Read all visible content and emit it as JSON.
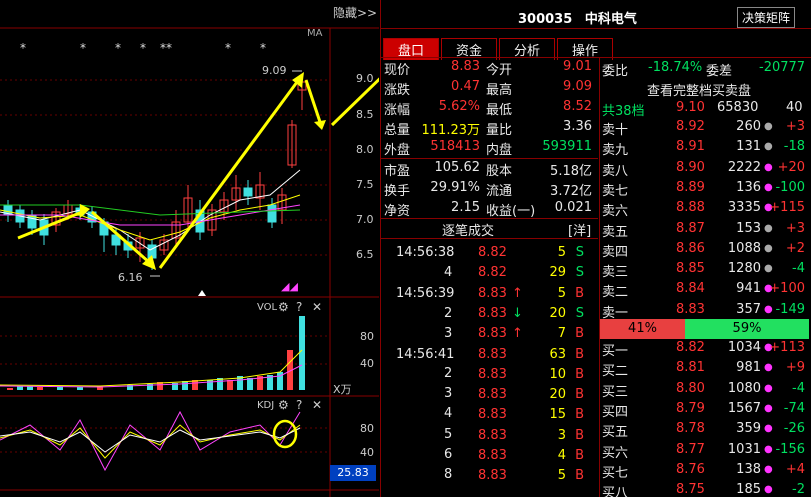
{
  "chart": {
    "hide_label": "隐藏>>",
    "ma_label": "MA",
    "high_label": "9.09",
    "low_label": "6.16",
    "price_ticks": [
      "9.0",
      "8.5",
      "8.0",
      "7.5",
      "7.0",
      "6.5"
    ],
    "vol_label": "VOL",
    "vol_ticks": [
      "80",
      "40"
    ],
    "vol_unit": "X万",
    "kdj_label": "KDJ",
    "kdj_ticks": [
      "80",
      "40"
    ],
    "kdj_value": "25.83",
    "stars": [
      "*",
      "*",
      "*",
      "*",
      "**",
      "*",
      "*"
    ]
  },
  "header": {
    "code": "300035",
    "name": "中科电气",
    "matrix_btn": "决策矩阵"
  },
  "tabs": [
    "盘口",
    "资金",
    "分析",
    "操作"
  ],
  "quote": [
    {
      "l1": "现价",
      "v1": "8.83",
      "c1": "red",
      "l2": "今开",
      "v2": "9.01",
      "c2": "red"
    },
    {
      "l1": "涨跌",
      "v1": "0.47",
      "c1": "red",
      "l2": "最高",
      "v2": "9.09",
      "c2": "red"
    },
    {
      "l1": "涨幅",
      "v1": "5.62%",
      "c1": "red",
      "l2": "最低",
      "v2": "8.52",
      "c2": "red"
    },
    {
      "l1": "总量",
      "v1": "111.23万",
      "c1": "yellow",
      "l2": "量比",
      "v2": "3.36",
      "c2": "white"
    },
    {
      "l1": "外盘",
      "v1": "518413",
      "c1": "red",
      "l2": "内盘",
      "v2": "593911",
      "c2": "green"
    },
    {
      "l1": "市盈",
      "v1": "105.62",
      "c1": "white",
      "l2": "股本",
      "v2": "5.18亿",
      "c2": "white"
    },
    {
      "l1": "换手",
      "v1": "29.91%",
      "c1": "white",
      "l2": "流通",
      "v2": "3.72亿",
      "c2": "white"
    },
    {
      "l1": "净资",
      "v1": "2.15",
      "c1": "white",
      "l2": "收益(一)",
      "v2": "0.021",
      "c2": "white"
    }
  ],
  "ticks_header": {
    "title": "逐笔成交",
    "more": "[洋]"
  },
  "ticks": [
    {
      "time": "14:56:38",
      "price": "8.82",
      "vol": "5",
      "dir": "S",
      "pc": "red",
      "dc": "green"
    },
    {
      "time": "",
      "price": "8.82",
      "vol": "29",
      "dir": "S",
      "pc": "red",
      "dc": "green"
    },
    {
      "time": "14:56:39",
      "price": "8.83",
      "arrow": "↑",
      "ac": "red",
      "vol": "5",
      "dir": "B",
      "pc": "red",
      "dc": "red"
    },
    {
      "time": "",
      "price": "8.83",
      "arrow": "↓",
      "ac": "green",
      "vol": "20",
      "dir": "S",
      "pc": "red",
      "dc": "green"
    },
    {
      "time": "",
      "price": "8.83",
      "arrow": "↑",
      "ac": "red",
      "vol": "7",
      "dir": "B",
      "pc": "red",
      "dc": "red"
    },
    {
      "time": "14:56:41",
      "price": "8.83",
      "vol": "63",
      "dir": "B",
      "pc": "red",
      "dc": "red"
    },
    {
      "time": "",
      "price": "8.83",
      "vol": "10",
      "dir": "B",
      "pc": "red",
      "dc": "red"
    },
    {
      "time": "",
      "price": "8.83",
      "vol": "20",
      "dir": "B",
      "pc": "red",
      "dc": "red"
    },
    {
      "time": "",
      "price": "8.83",
      "vol": "15",
      "dir": "B",
      "pc": "red",
      "dc": "red"
    },
    {
      "time": "",
      "price": "8.83",
      "vol": "3",
      "dir": "B",
      "pc": "red",
      "dc": "red"
    },
    {
      "time": "",
      "price": "8.83",
      "vol": "4",
      "dir": "B",
      "pc": "red",
      "dc": "red"
    },
    {
      "time": "",
      "price": "8.83",
      "vol": "5",
      "dir": "B",
      "pc": "red",
      "dc": "red"
    }
  ],
  "tick_side_numbers": [
    "4",
    "2",
    "3",
    "2",
    "3",
    "4",
    "5",
    "6",
    "8"
  ],
  "book": {
    "wei_bi_label": "委比",
    "wei_bi": "-18.74%",
    "wei_cha_label": "委差",
    "wei_cha": "-20777",
    "full_book": "查看完整档买卖盘",
    "total_sell": {
      "label": "共38档",
      "price": "9.10",
      "vol": "65830",
      "chg": "40"
    },
    "asks": [
      {
        "label": "卖十",
        "price": "8.92",
        "vol": "260",
        "chg": "+3",
        "dot": "gray",
        "cc": "red"
      },
      {
        "label": "卖九",
        "price": "8.91",
        "vol": "131",
        "chg": "-18",
        "dot": "gray",
        "cc": "green"
      },
      {
        "label": "卖八",
        "price": "8.90",
        "vol": "2222",
        "chg": "+20",
        "dot": "magenta",
        "cc": "red"
      },
      {
        "label": "卖七",
        "price": "8.89",
        "vol": "136",
        "chg": "-100",
        "dot": "magenta",
        "cc": "green"
      },
      {
        "label": "卖六",
        "price": "8.88",
        "vol": "3335",
        "chg": "+115",
        "dot": "magenta",
        "cc": "red"
      },
      {
        "label": "卖五",
        "price": "8.87",
        "vol": "153",
        "chg": "+3",
        "dot": "gray",
        "cc": "red"
      },
      {
        "label": "卖四",
        "price": "8.86",
        "vol": "1088",
        "chg": "+2",
        "dot": "gray",
        "cc": "red"
      },
      {
        "label": "卖三",
        "price": "8.85",
        "vol": "1280",
        "chg": "-4",
        "dot": "gray",
        "cc": "green"
      },
      {
        "label": "卖二",
        "price": "8.84",
        "vol": "941",
        "chg": "+100",
        "dot": "magenta",
        "cc": "red"
      },
      {
        "label": "卖一",
        "price": "8.83",
        "vol": "357",
        "chg": "-149",
        "dot": "magenta",
        "cc": "green"
      }
    ],
    "ratio": {
      "buy": "41%",
      "sell": "59%"
    },
    "bids": [
      {
        "label": "买一",
        "price": "8.82",
        "vol": "1034",
        "chg": "+113",
        "dot": "magenta",
        "cc": "red"
      },
      {
        "label": "买二",
        "price": "8.81",
        "vol": "981",
        "chg": "+9",
        "dot": "magenta",
        "cc": "red"
      },
      {
        "label": "买三",
        "price": "8.80",
        "vol": "1080",
        "chg": "-4",
        "dot": "magenta",
        "cc": "green"
      },
      {
        "label": "买四",
        "price": "8.79",
        "vol": "1567",
        "chg": "-74",
        "dot": "magenta",
        "cc": "green"
      },
      {
        "label": "买五",
        "price": "8.78",
        "vol": "359",
        "chg": "-26",
        "dot": "magenta",
        "cc": "green"
      },
      {
        "label": "买六",
        "price": "8.77",
        "vol": "1031",
        "chg": "-156",
        "dot": "magenta",
        "cc": "green"
      },
      {
        "label": "买七",
        "price": "8.76",
        "vol": "138",
        "chg": "+4",
        "dot": "magenta",
        "cc": "red"
      },
      {
        "label": "买八",
        "price": "8.75",
        "vol": "185",
        "chg": "-2",
        "dot": "magenta",
        "cc": "green"
      }
    ]
  }
}
